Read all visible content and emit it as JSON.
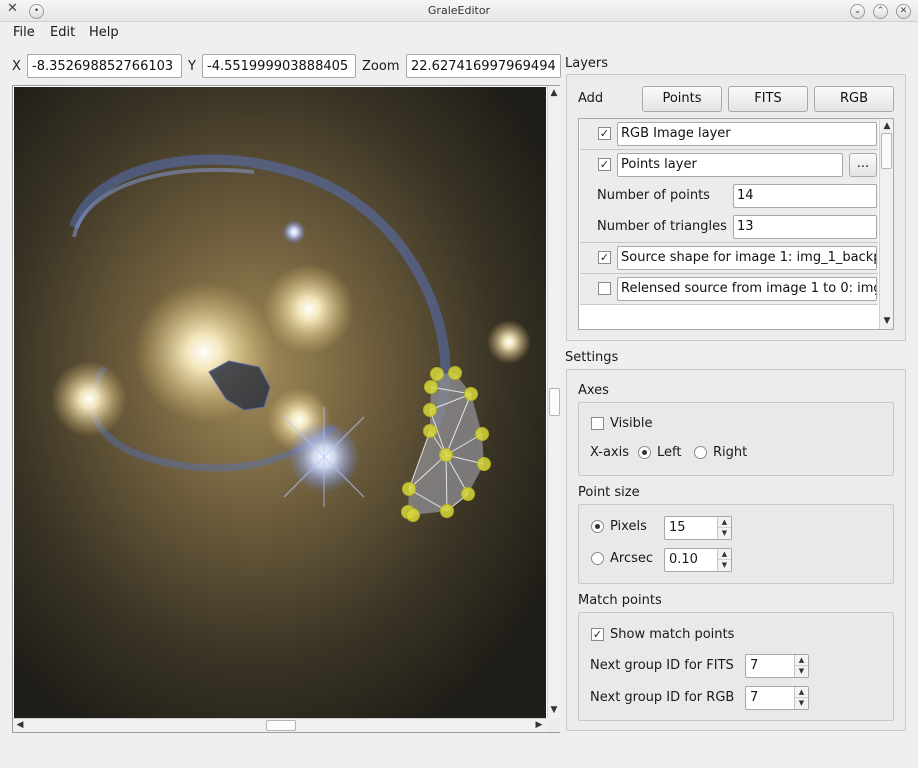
{
  "window": {
    "title": "GraleEditor"
  },
  "menu": {
    "file": "File",
    "edit": "Edit",
    "help": "Help"
  },
  "coords": {
    "x_label": "X",
    "x_value": "-8.352698852766103",
    "y_label": "Y",
    "y_value": "-4.551999903888405",
    "zoom_label": "Zoom",
    "zoom_value": "22.627416997969494"
  },
  "layers": {
    "title": "Layers",
    "add_label": "Add",
    "add_points": "Points",
    "add_fits": "FITS",
    "add_rgb": "RGB",
    "rgb_layer": {
      "name": "RGB Image layer",
      "checked": true
    },
    "points_layer": {
      "name": "Points layer",
      "checked": true,
      "more_button": "...",
      "num_points_label": "Number of points",
      "num_points": "14",
      "num_triangles_label": "Number of triangles",
      "num_triangles": "13"
    },
    "source_shape": {
      "name": "Source shape for image 1: img_1_backp",
      "checked": true
    },
    "relensed": {
      "name": "Relensed source from image 1 to 0: img",
      "checked": false
    }
  },
  "settings": {
    "title": "Settings",
    "axes": {
      "title": "Axes",
      "visible_label": "Visible",
      "visible": false,
      "xaxis_label": "X-axis",
      "left_label": "Left",
      "right_label": "Right",
      "selected": "Left"
    },
    "point_size": {
      "title": "Point size",
      "pixels_label": "Pixels",
      "pixels_value": "15",
      "arcsec_label": "Arcsec",
      "arcsec_value": "0.10",
      "selected": "Pixels"
    },
    "match_points": {
      "title": "Match points",
      "show_label": "Show match points",
      "show": true,
      "fits_label": "Next group ID for FITS",
      "fits_value": "7",
      "rgb_label": "Next group ID for RGB",
      "rgb_value": "7"
    }
  },
  "colors": {
    "point_fill": "#d8d83a",
    "polygon_fill": "#8f8f94",
    "background_sky": "#2a2418"
  }
}
